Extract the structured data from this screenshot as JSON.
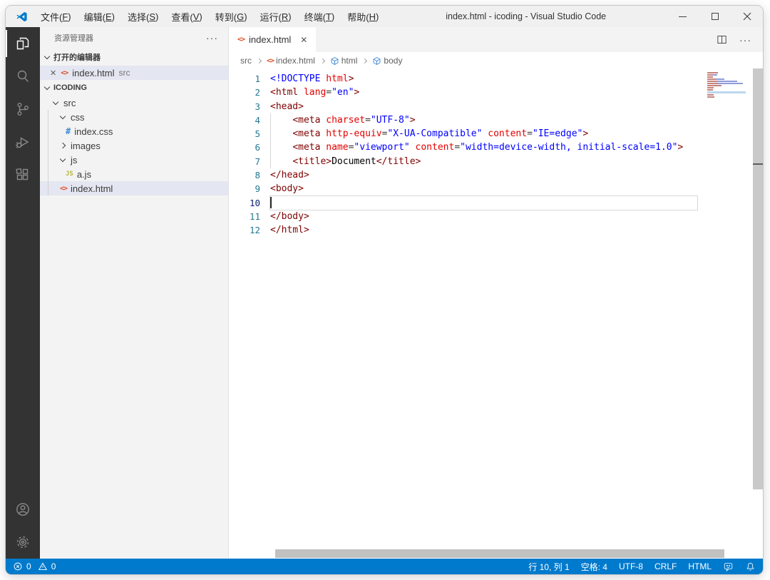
{
  "titlebar": {
    "title": "index.html - icoding - Visual Studio Code",
    "menus": [
      {
        "pre": "文件(",
        "key": "F",
        "post": ")"
      },
      {
        "pre": "编辑(",
        "key": "E",
        "post": ")"
      },
      {
        "pre": "选择(",
        "key": "S",
        "post": ")"
      },
      {
        "pre": "查看(",
        "key": "V",
        "post": ")"
      },
      {
        "pre": "转到(",
        "key": "G",
        "post": ")"
      },
      {
        "pre": "运行(",
        "key": "R",
        "post": ")"
      },
      {
        "pre": "终端(",
        "key": "T",
        "post": ")"
      },
      {
        "pre": "帮助(",
        "key": "H",
        "post": ")"
      }
    ]
  },
  "activitybar": {
    "items": [
      "explorer",
      "search",
      "source-control",
      "run-and-debug",
      "extensions"
    ],
    "bottom": [
      "account",
      "manage"
    ]
  },
  "sidebar": {
    "title": "资源管理器",
    "more_label": "···",
    "open_editors": {
      "label": "打开的编辑器",
      "item": {
        "close": "✕",
        "file": "index.html",
        "detail": "src"
      }
    },
    "root": "ICODING",
    "tree": [
      {
        "label": "src"
      },
      {
        "label": "css"
      },
      {
        "label": "index.css",
        "badge": "#"
      },
      {
        "label": "images"
      },
      {
        "label": "js"
      },
      {
        "label": "a.js",
        "badge": "JS"
      },
      {
        "label": "index.html",
        "badge": "<>"
      }
    ]
  },
  "editor": {
    "tab": {
      "icon": "<>",
      "label": "index.html",
      "close": "✕"
    },
    "actions_more": "···",
    "breadcrumbs": [
      {
        "label": "src"
      },
      {
        "label": "index.html",
        "icon": "<>"
      },
      {
        "label": "html"
      },
      {
        "label": "body"
      }
    ],
    "lines": [
      {
        "n": "1",
        "tokens": [
          {
            "c": "doctype",
            "t": "<!DOCTYPE"
          },
          {
            "c": "plain",
            "t": " "
          },
          {
            "c": "attr",
            "t": "html"
          },
          {
            "c": "tag",
            "t": ">"
          }
        ]
      },
      {
        "n": "2",
        "tokens": [
          {
            "c": "tag",
            "t": "<html"
          },
          {
            "c": "plain",
            "t": " "
          },
          {
            "c": "attr",
            "t": "lang"
          },
          {
            "c": "eq",
            "t": "="
          },
          {
            "c": "str",
            "t": "\"en\""
          },
          {
            "c": "tag",
            "t": ">"
          }
        ]
      },
      {
        "n": "3",
        "tokens": [
          {
            "c": "tag",
            "t": "<head>"
          }
        ]
      },
      {
        "n": "4",
        "tokens": [
          {
            "c": "plain",
            "t": "    "
          },
          {
            "c": "tag",
            "t": "<meta"
          },
          {
            "c": "plain",
            "t": " "
          },
          {
            "c": "attr",
            "t": "charset"
          },
          {
            "c": "eq",
            "t": "="
          },
          {
            "c": "str",
            "t": "\"UTF-8\""
          },
          {
            "c": "tag",
            "t": ">"
          }
        ]
      },
      {
        "n": "5",
        "tokens": [
          {
            "c": "plain",
            "t": "    "
          },
          {
            "c": "tag",
            "t": "<meta"
          },
          {
            "c": "plain",
            "t": " "
          },
          {
            "c": "attr",
            "t": "http-equiv"
          },
          {
            "c": "eq",
            "t": "="
          },
          {
            "c": "str",
            "t": "\"X-UA-Compatible\""
          },
          {
            "c": "plain",
            "t": " "
          },
          {
            "c": "attr",
            "t": "content"
          },
          {
            "c": "eq",
            "t": "="
          },
          {
            "c": "str",
            "t": "\"IE=edge\""
          },
          {
            "c": "tag",
            "t": ">"
          }
        ]
      },
      {
        "n": "6",
        "tokens": [
          {
            "c": "plain",
            "t": "    "
          },
          {
            "c": "tag",
            "t": "<meta"
          },
          {
            "c": "plain",
            "t": " "
          },
          {
            "c": "attr",
            "t": "name"
          },
          {
            "c": "eq",
            "t": "="
          },
          {
            "c": "str",
            "t": "\"viewport\""
          },
          {
            "c": "plain",
            "t": " "
          },
          {
            "c": "attr",
            "t": "content"
          },
          {
            "c": "eq",
            "t": "="
          },
          {
            "c": "str",
            "t": "\"width=device-width, initial-scale=1.0\""
          },
          {
            "c": "tag",
            "t": ">"
          }
        ]
      },
      {
        "n": "7",
        "tokens": [
          {
            "c": "plain",
            "t": "    "
          },
          {
            "c": "tag",
            "t": "<title>"
          },
          {
            "c": "text",
            "t": "Document"
          },
          {
            "c": "tag",
            "t": "</title>"
          }
        ]
      },
      {
        "n": "8",
        "tokens": [
          {
            "c": "tag",
            "t": "</head>"
          }
        ]
      },
      {
        "n": "9",
        "tokens": [
          {
            "c": "tag",
            "t": "<body>"
          }
        ]
      },
      {
        "n": "10",
        "tokens": []
      },
      {
        "n": "11",
        "tokens": [
          {
            "c": "tag",
            "t": "</body>"
          }
        ]
      },
      {
        "n": "12",
        "tokens": [
          {
            "c": "tag",
            "t": "</html>"
          }
        ]
      }
    ]
  },
  "statusbar": {
    "errors": "0",
    "warnings": "0",
    "cursor": "行 10, 列 1",
    "indent": "空格: 4",
    "encoding": "UTF-8",
    "eol": "CRLF",
    "language": "HTML"
  },
  "colors": {
    "accent": "#007acc",
    "activity_bar": "#333333",
    "selection_bg": "#e4e6f1",
    "tag": "#800000",
    "attribute": "#e50000",
    "string": "#0000ff"
  }
}
